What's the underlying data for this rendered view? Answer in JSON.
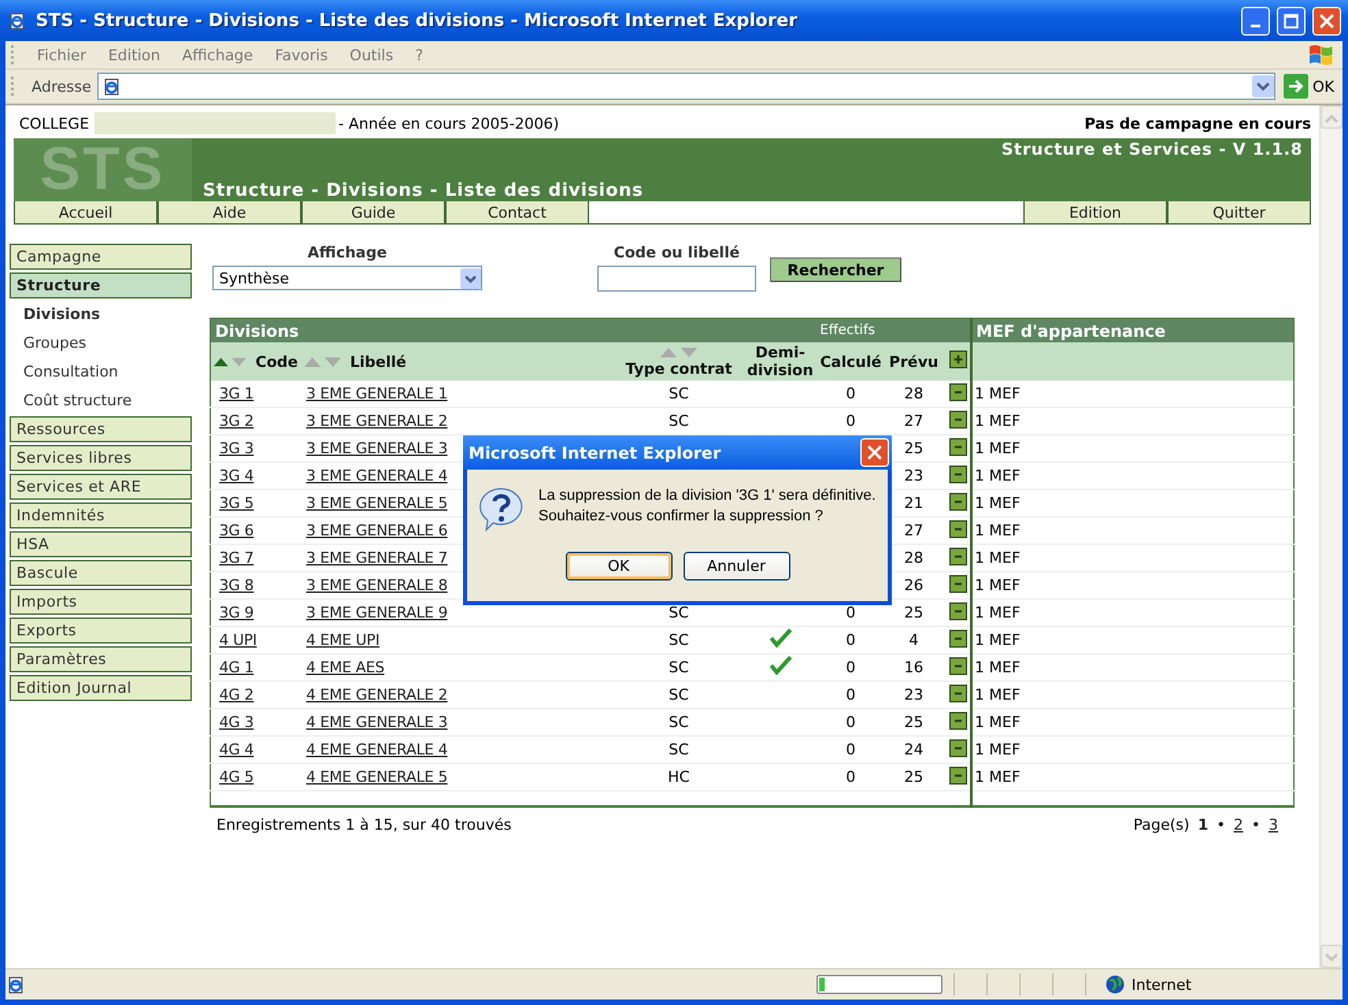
{
  "window": {
    "title": "STS - Structure - Divisions - Liste des divisions - Microsoft Internet Explorer"
  },
  "menu": [
    "Fichier",
    "Edition",
    "Affichage",
    "Favoris",
    "Outils",
    "?"
  ],
  "address_bar": {
    "label": "Adresse",
    "go": "OK"
  },
  "header": {
    "college_label": "COLLEGE",
    "year": "- Année en cours 2005-2006)",
    "campaign": "Pas de campagne en cours"
  },
  "banner": {
    "logo": "STS",
    "app": "Structure et Services - V 1.1.8",
    "page_title": "Structure - Divisions - Liste des divisions"
  },
  "nav_left": [
    "Accueil",
    "Aide",
    "Guide",
    "Contact"
  ],
  "nav_right": [
    "Edition",
    "Quitter"
  ],
  "sidebar": {
    "items": [
      {
        "label": "Campagne",
        "selected": false
      },
      {
        "label": "Structure",
        "selected": true,
        "children": [
          {
            "label": "Divisions",
            "selected": true
          },
          {
            "label": "Groupes",
            "selected": false
          },
          {
            "label": "Consultation",
            "selected": false
          },
          {
            "label": "Coût structure",
            "selected": false
          }
        ]
      },
      {
        "label": "Ressources",
        "selected": false
      },
      {
        "label": "Services libres",
        "selected": false
      },
      {
        "label": "Services et ARE",
        "selected": false
      },
      {
        "label": "Indemnités",
        "selected": false
      },
      {
        "label": "HSA",
        "selected": false
      },
      {
        "label": "Bascule",
        "selected": false
      },
      {
        "label": "Imports",
        "selected": false
      },
      {
        "label": "Exports",
        "selected": false
      },
      {
        "label": "Paramètres",
        "selected": false
      },
      {
        "label": "Edition Journal",
        "selected": false
      }
    ]
  },
  "filters": {
    "display_label": "Affichage",
    "display_value": "Synthèse",
    "search_label": "Code ou libellé",
    "search_button": "Rechercher"
  },
  "table": {
    "title": "Divisions",
    "group": "Effectifs",
    "mef_title": "MEF d'appartenance",
    "columns": [
      {
        "label": "Code",
        "sorted": true
      },
      {
        "label": "Libellé",
        "sorted": false
      },
      {
        "label": "Type contrat",
        "sorted": false
      },
      {
        "label": "Demi-division"
      },
      {
        "label": "Calculé"
      },
      {
        "label": "Prévu"
      }
    ],
    "rows": [
      {
        "code": "3G 1",
        "label": "3 EME GENERALE 1",
        "type": "SC",
        "demi_division": false,
        "calcule": "0",
        "prevu": "28",
        "mef": "1 MEF"
      },
      {
        "code": "3G 2",
        "label": "3 EME GENERALE 2",
        "type": "SC",
        "demi_division": false,
        "calcule": "0",
        "prevu": "27",
        "mef": "1 MEF"
      },
      {
        "code": "3G 3",
        "label": "3 EME GENERALE 3",
        "prevu": "25",
        "mef": "1 MEF"
      },
      {
        "code": "3G 4",
        "label": "3 EME GENERALE 4",
        "prevu": "23",
        "mef": "1 MEF"
      },
      {
        "code": "3G 5",
        "label": "3 EME GENERALE 5",
        "prevu": "21",
        "mef": "1 MEF"
      },
      {
        "code": "3G 6",
        "label": "3 EME GENERALE 6",
        "prevu": "27",
        "mef": "1 MEF"
      },
      {
        "code": "3G 7",
        "label": "3 EME GENERALE 7",
        "prevu": "28",
        "mef": "1 MEF"
      },
      {
        "code": "3G 8",
        "label": "3 EME GENERALE 8",
        "prevu": "26",
        "mef": "1 MEF"
      },
      {
        "code": "3G 9",
        "label": "3 EME GENERALE 9",
        "type": "SC",
        "demi_division": false,
        "calcule": "0",
        "prevu": "25",
        "mef": "1 MEF"
      },
      {
        "code": "4 UPI",
        "label": "4 EME UPI",
        "type": "SC",
        "demi_division": true,
        "calcule": "0",
        "prevu": "4",
        "mef": "1 MEF"
      },
      {
        "code": "4G 1",
        "label": "4 EME AES",
        "type": "SC",
        "demi_division": true,
        "calcule": "0",
        "prevu": "16",
        "mef": "1 MEF"
      },
      {
        "code": "4G 2",
        "label": "4 EME GENERALE 2",
        "type": "SC",
        "demi_division": false,
        "calcule": "0",
        "prevu": "23",
        "mef": "1 MEF"
      },
      {
        "code": "4G 3",
        "label": "4 EME GENERALE 3",
        "type": "SC",
        "demi_division": false,
        "calcule": "0",
        "prevu": "25",
        "mef": "1 MEF"
      },
      {
        "code": "4G 4",
        "label": "4 EME GENERALE 4",
        "type": "SC",
        "demi_division": false,
        "calcule": "0",
        "prevu": "24",
        "mef": "1 MEF"
      },
      {
        "code": "4G 5",
        "label": "4 EME GENERALE 5",
        "type": "HC",
        "demi_division": false,
        "calcule": "0",
        "prevu": "25",
        "mef": "1 MEF"
      }
    ]
  },
  "footer": {
    "records": "Enregistrements 1 à 15, sur 40 trouvés",
    "pages_label": "Page(s)",
    "pages": [
      {
        "label": "1",
        "selected": true
      },
      {
        "label": "2",
        "selected": false,
        "separator": "•"
      },
      {
        "label": "3",
        "selected": false,
        "separator": "•"
      }
    ]
  },
  "dialog": {
    "title": "Microsoft Internet Explorer",
    "message": "La suppression de la division '3G 1' sera définitive.\nSouhaitez-vous confirmer la suppression ?",
    "buttons": [
      {
        "label": "OK",
        "selected": true
      },
      {
        "label": "Annuler",
        "selected": false
      }
    ]
  },
  "status_bar": {
    "level": 0.05,
    "zone": "Internet"
  }
}
